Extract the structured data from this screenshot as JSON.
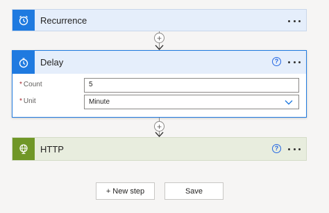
{
  "steps": {
    "recurrence": {
      "title": "Recurrence",
      "icon": "alarm-clock-icon",
      "color": "#1f7ae0"
    },
    "delay": {
      "title": "Delay",
      "icon": "timer-icon",
      "color": "#1f7ae0",
      "help_label": "?",
      "fields": {
        "count": {
          "label": "Count",
          "required_mark": "*",
          "value": "5"
        },
        "unit": {
          "label": "Unit",
          "required_mark": "*",
          "value": "Minute"
        }
      }
    },
    "http": {
      "title": "HTTP",
      "icon": "globe-icon",
      "color": "#709727",
      "help_label": "?"
    }
  },
  "connectors": {
    "add_symbol": "+"
  },
  "footer": {
    "new_step_label": "+ New step",
    "save_label": "Save"
  }
}
